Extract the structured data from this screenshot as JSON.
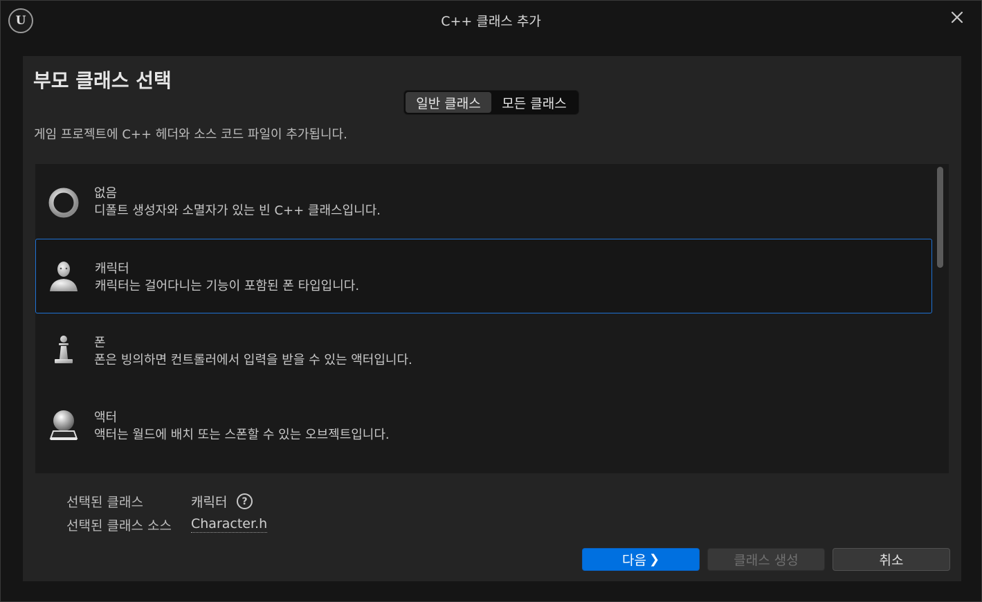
{
  "window": {
    "title": "C++ 클래스 추가",
    "logo_text": "U"
  },
  "panel": {
    "heading": "부모 클래스 선택",
    "tabs": [
      {
        "label": "일반 클래스",
        "active": true
      },
      {
        "label": "모든 클래스",
        "active": false
      }
    ],
    "description": "게임 프로젝트에 C++ 헤더와 소스 코드 파일이 추가됩니다."
  },
  "class_list": {
    "items": [
      {
        "title": "없음",
        "description": "디폴트 생성자와 소멸자가 있는 빈 C++ 클래스입니다.",
        "icon": "ring-icon",
        "selected": false
      },
      {
        "title": "캐릭터",
        "description": "캐릭터는 걸어다니는 기능이 포함된 폰 타입입니다.",
        "icon": "character-icon",
        "selected": true
      },
      {
        "title": "폰",
        "description": "폰은 빙의하면 컨트롤러에서 입력을 받을 수 있는 액터입니다.",
        "icon": "pawn-icon",
        "selected": false
      },
      {
        "title": "액터",
        "description": "액터는 월드에 배치 또는 스폰할 수 있는 오브젝트입니다.",
        "icon": "actor-icon",
        "selected": false
      }
    ]
  },
  "selection_info": {
    "class_label": "선택된 클래스",
    "class_value": "캐릭터",
    "source_label": "선택된 클래스 소스",
    "source_value": "Character.h",
    "help_glyph": "?"
  },
  "buttons": {
    "next": "다음",
    "next_chevron": "❯",
    "create": "클래스 생성",
    "cancel": "취소"
  },
  "colors": {
    "accent": "#0070e0",
    "selection_border": "#1f73d6",
    "panel_bg": "#242424",
    "list_bg": "#1a1a1a"
  }
}
